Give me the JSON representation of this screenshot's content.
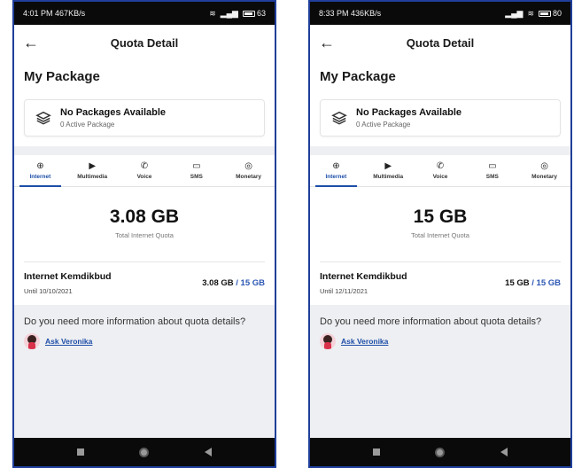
{
  "screens": [
    {
      "status": {
        "time": "4:01 PM",
        "speed": "467KB/s",
        "battery": "63"
      },
      "appbar": {
        "title": "Quota Detail"
      },
      "section_title": "My Package",
      "package_card": {
        "title": "No Packages Available",
        "subtitle": "0 Active Package"
      },
      "tabs": [
        {
          "label": "Internet",
          "icon": "globe-icon",
          "glyph": "⊕",
          "active": true
        },
        {
          "label": "Multimedia",
          "icon": "play-icon",
          "glyph": "▶",
          "active": false
        },
        {
          "label": "Voice",
          "icon": "phone-icon",
          "glyph": "✆",
          "active": false
        },
        {
          "label": "SMS",
          "icon": "chat-icon",
          "glyph": "▭",
          "active": false
        },
        {
          "label": "Monetary",
          "icon": "coin-icon",
          "glyph": "◎",
          "active": false
        }
      ],
      "quota": {
        "value": "3.08 GB",
        "caption": "Total Internet Quota"
      },
      "plan": {
        "name": "Internet Kemdikbud",
        "until": "Until 10/10/2021",
        "used": "3.08 GB",
        "total": " / 15 GB"
      },
      "info": {
        "text": "Do you need more information about quota details?",
        "link": "Ask Veronika"
      }
    },
    {
      "status": {
        "time": "8:33 PM",
        "speed": "436KB/s",
        "battery": "80"
      },
      "appbar": {
        "title": "Quota Detail"
      },
      "section_title": "My Package",
      "package_card": {
        "title": "No Packages Available",
        "subtitle": "0 Active Package"
      },
      "tabs": [
        {
          "label": "Internet",
          "icon": "globe-icon",
          "glyph": "⊕",
          "active": true
        },
        {
          "label": "Multimedia",
          "icon": "play-icon",
          "glyph": "▶",
          "active": false
        },
        {
          "label": "Voice",
          "icon": "phone-icon",
          "glyph": "✆",
          "active": false
        },
        {
          "label": "SMS",
          "icon": "chat-icon",
          "glyph": "▭",
          "active": false
        },
        {
          "label": "Monetary",
          "icon": "coin-icon",
          "glyph": "◎",
          "active": false
        }
      ],
      "quota": {
        "value": "15 GB",
        "caption": "Total Internet Quota"
      },
      "plan": {
        "name": "Internet Kemdikbud",
        "until": "Until 12/11/2021",
        "used": "15 GB",
        "total": " / 15 GB"
      },
      "info": {
        "text": "Do you need more information about quota details?",
        "link": "Ask Veronika"
      }
    }
  ],
  "colors": {
    "accent": "#1d4ea8",
    "frame": "#1f3f9a",
    "gray_bg": "#eeeff2"
  }
}
